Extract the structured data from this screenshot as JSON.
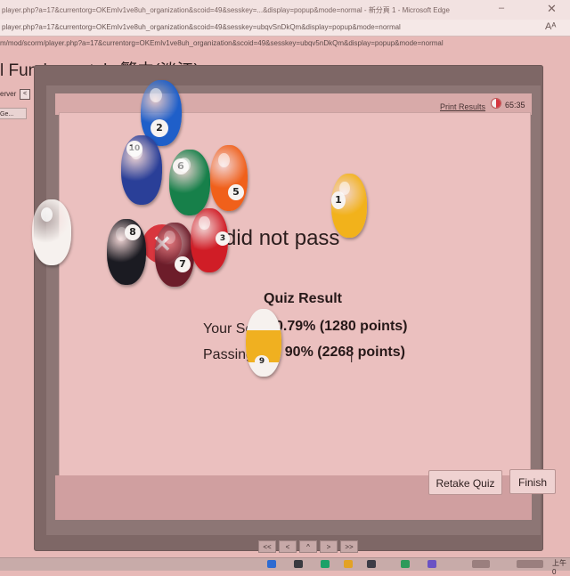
{
  "browser": {
    "title_url": "player.php?a=17&currentorg=OKEmIv1ve8uh_organization&scoid=49&sesskey=...&display=popup&mode=normal - 新分頁 1 - Microsoft Edge",
    "window_title": "Microsoft Edge",
    "address_url": "player.php?a=17&currentorg=OKEmIv1ve8uh_organization&scoid=49&sesskey=ubqvSnDkQm&display=popup&mode=normal"
  },
  "page": {
    "content_url": "m/mod/scorm/player.php?a=17&currentorg=OKEmIv1ve8uh_organization&scoid=49&sesskey=ubqv5nDkQm&display=popup&mode=normal",
    "course_title": "l Fundamentals 繁中(淡江)",
    "sidebar_label": "erver",
    "sidebar_toggle": "<",
    "sidebar_button": "Ge..."
  },
  "quiz": {
    "print_results": "Print Results",
    "timer": "65:35",
    "heading": "did not pass",
    "result_title": "Quiz Result",
    "your_score_label": "Your Sc",
    "your_score_value": "0.79% (1280 points)",
    "passing_label": "Passing",
    "passing_value": ": 90% (2268 points)",
    "retake_label": "Retake Quiz",
    "finish_label": "Finish"
  },
  "pager": [
    "<<",
    "<",
    "^",
    ">",
    ">>"
  ],
  "taskbar": {
    "clock": "上午0"
  },
  "balls": [
    {
      "name": "ball-2-blue",
      "number": "2",
      "color": "#1f5fc9"
    },
    {
      "name": "ball-10-blue-stripe",
      "number": "10",
      "color": "#2a3f98"
    },
    {
      "name": "ball-6-green",
      "number": "6",
      "color": "#17804a"
    },
    {
      "name": "ball-5-orange",
      "number": "5",
      "color": "#f0601b"
    },
    {
      "name": "ball-1-yellow",
      "number": "1",
      "color": "#f2b21b"
    },
    {
      "name": "ball-8-black",
      "number": "8",
      "color": "#1b1b22"
    },
    {
      "name": "ball-7-maroon",
      "number": "7",
      "color": "#6d1d2a"
    },
    {
      "name": "ball-3-red",
      "number": "3",
      "color": "#d01d26"
    },
    {
      "name": "ball-9-yellow-stripe",
      "number": "9",
      "color": "#f0b020"
    },
    {
      "name": "cue-ball",
      "number": "",
      "color": "#f6f1ee"
    }
  ],
  "colors": {
    "accent_fail": "#d9363e",
    "panel_bg": "#ebc0bf"
  }
}
